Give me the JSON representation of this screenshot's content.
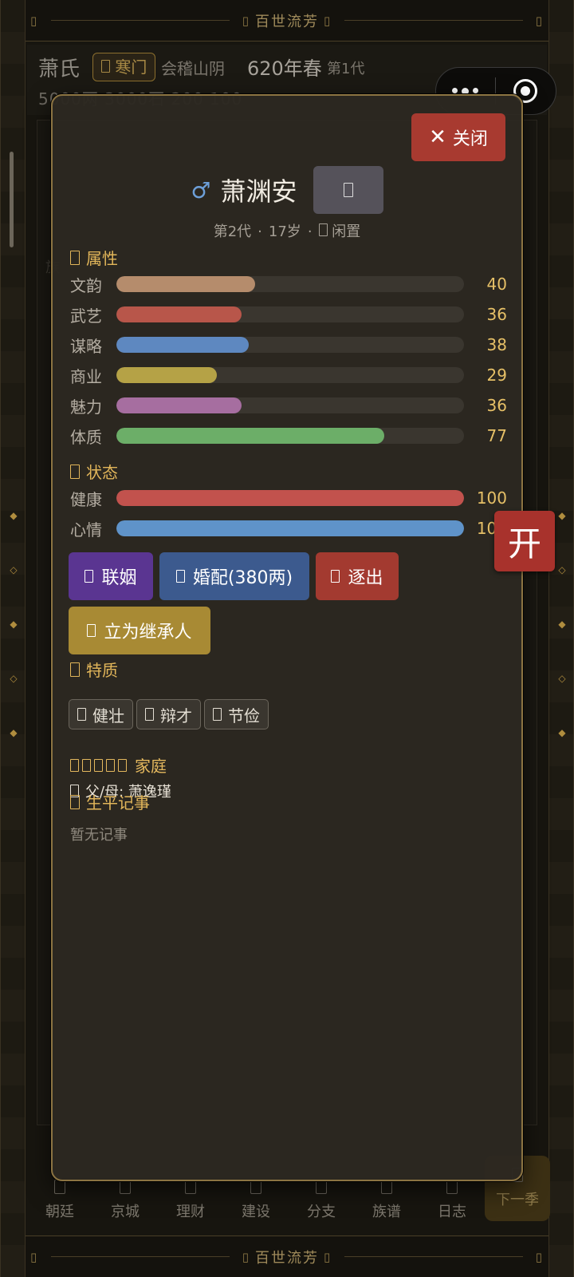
{
  "app": {
    "banner_top": "百世流芳",
    "banner_bottom": "百世流芳"
  },
  "header": {
    "clan_name": "萧氏",
    "clan_rank": "寒门",
    "location": "会稽山阴",
    "date": "620年春",
    "generation": "第1代",
    "resources": "5000两 3000石 200 100"
  },
  "bottom_nav": {
    "items": [
      "朝廷",
      "京城",
      "理财",
      "建设",
      "分支",
      "族谱",
      "日志"
    ],
    "next_season": "下一季"
  },
  "floating": {
    "open_label": "开"
  },
  "modal": {
    "close_label": "关闭",
    "gender_symbol": "♂",
    "name": "萧渊安",
    "generation": "第2代",
    "age": "17岁",
    "status": "闲置",
    "attributes_title": "属性",
    "attributes": [
      {
        "label": "文韵",
        "value": 40,
        "color": "#b58c6c"
      },
      {
        "label": "武艺",
        "value": 36,
        "color": "#b8564a"
      },
      {
        "label": "谋略",
        "value": 38,
        "color": "#5e88c0"
      },
      {
        "label": "商业",
        "value": 29,
        "color": "#b5a246"
      },
      {
        "label": "魅力",
        "value": 36,
        "color": "#a66ea0"
      },
      {
        "label": "体质",
        "value": 77,
        "color": "#6cae68"
      }
    ],
    "state_title": "状态",
    "states": [
      {
        "label": "健康",
        "value": 100,
        "color": "#c2524d"
      },
      {
        "label": "心情",
        "value": 100,
        "color": "#5f93c9"
      }
    ],
    "actions": {
      "marriage_alliance": "联姻",
      "marriage_match": "婚配(380两)",
      "expel": "逐出",
      "heir": "立为继承人"
    },
    "action_colors": {
      "marriage_alliance": "#5a3591",
      "marriage_match": "#3c5a8e",
      "expel": "#a33a30",
      "heir": "#a88a34"
    },
    "traits_title": "特质",
    "traits": [
      "健壮",
      "辩才",
      "节俭"
    ],
    "family_title": "家庭",
    "parent_label": "父/母: 萧逸瑾",
    "records_title": "生平记事",
    "records_empty": "暂无记事"
  }
}
